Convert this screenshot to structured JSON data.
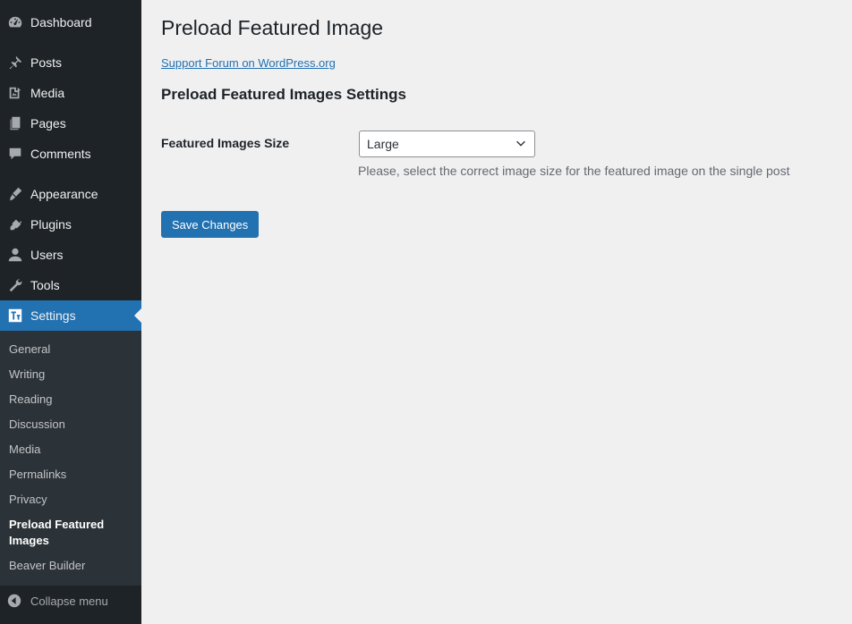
{
  "sidebar": {
    "items": [
      {
        "label": "Dashboard",
        "icon": "dashboard-icon"
      },
      {
        "label": "Posts",
        "icon": "pin-icon"
      },
      {
        "label": "Media",
        "icon": "media-icon"
      },
      {
        "label": "Pages",
        "icon": "pages-icon"
      },
      {
        "label": "Comments",
        "icon": "comment-icon"
      },
      {
        "label": "Appearance",
        "icon": "brush-icon"
      },
      {
        "label": "Plugins",
        "icon": "plug-icon"
      },
      {
        "label": "Users",
        "icon": "user-icon"
      },
      {
        "label": "Tools",
        "icon": "wrench-icon"
      },
      {
        "label": "Settings",
        "icon": "settings-icon",
        "active": true
      }
    ],
    "submenu": [
      {
        "label": "General"
      },
      {
        "label": "Writing"
      },
      {
        "label": "Reading"
      },
      {
        "label": "Discussion"
      },
      {
        "label": "Media"
      },
      {
        "label": "Permalinks"
      },
      {
        "label": "Privacy"
      },
      {
        "label": "Preload Featured Images",
        "current": true
      },
      {
        "label": "Beaver Builder"
      }
    ],
    "collapse_label": "Collapse menu"
  },
  "main": {
    "title": "Preload Featured Image",
    "support_link": "Support Forum on WordPress.org",
    "section_title": "Preload Featured Images Settings",
    "field_label": "Featured Images Size",
    "select_value": "Large",
    "description": "Please, select the correct image size for the featured image on the single post",
    "save_label": "Save Changes"
  },
  "colors": {
    "sidebar_bg": "#1d2327",
    "submenu_bg": "#2c3338",
    "accent": "#2271b1",
    "page_bg": "#f0f0f1"
  }
}
